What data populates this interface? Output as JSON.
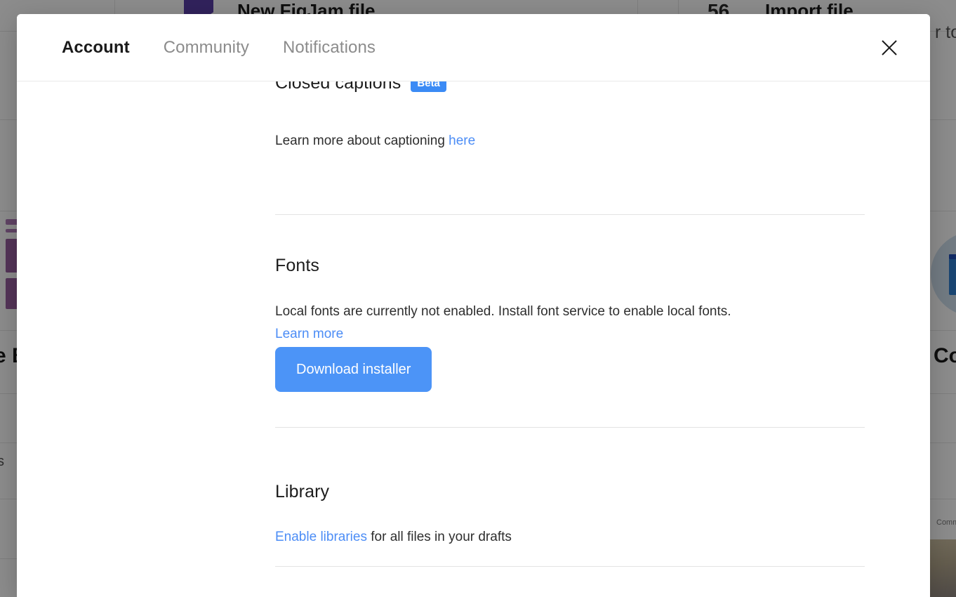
{
  "background": {
    "items": [
      {
        "label": "New FigJam file",
        "role": "file-action"
      },
      {
        "label": "Import file",
        "role": "file-action"
      },
      {
        "label": "56",
        "role": "import-count-icon"
      },
      {
        "label": "r too",
        "role": "clipped-text"
      },
      {
        "label": "e B",
        "role": "clipped-text"
      },
      {
        "label": "Com",
        "role": "clipped-text"
      },
      {
        "label": "s",
        "role": "clipped-text"
      },
      {
        "label": "Comma",
        "role": "clipped-tiny-text"
      }
    ]
  },
  "modal": {
    "tabs": [
      {
        "id": "account",
        "label": "Account",
        "active": true
      },
      {
        "id": "community",
        "label": "Community",
        "active": false
      },
      {
        "id": "notifications",
        "label": "Notifications",
        "active": false
      }
    ],
    "close_label": "×",
    "sections": {
      "captions": {
        "title": "Closed captions",
        "badge": "Beta",
        "description_prefix": "Learn more about captioning ",
        "link_label": "here"
      },
      "fonts": {
        "title": "Fonts",
        "description": "Local fonts are currently not enabled. Install font service to enable local fonts.",
        "learn_more_label": "Learn more",
        "download_button_label": "Download installer"
      },
      "library": {
        "title": "Library",
        "link_label": "Enable libraries",
        "description_suffix": " for all files in your drafts"
      }
    }
  },
  "colors": {
    "accent_blue": "#4c94f7",
    "link_blue": "#4c8df6",
    "badge_blue": "#3b8bf5",
    "text_dark": "#1c1c1c",
    "text_body": "#2e2e2e",
    "tab_inactive": "#8c8c8c",
    "divider": "#e3e3e3",
    "figjam_purple": "#5a3fa8"
  }
}
